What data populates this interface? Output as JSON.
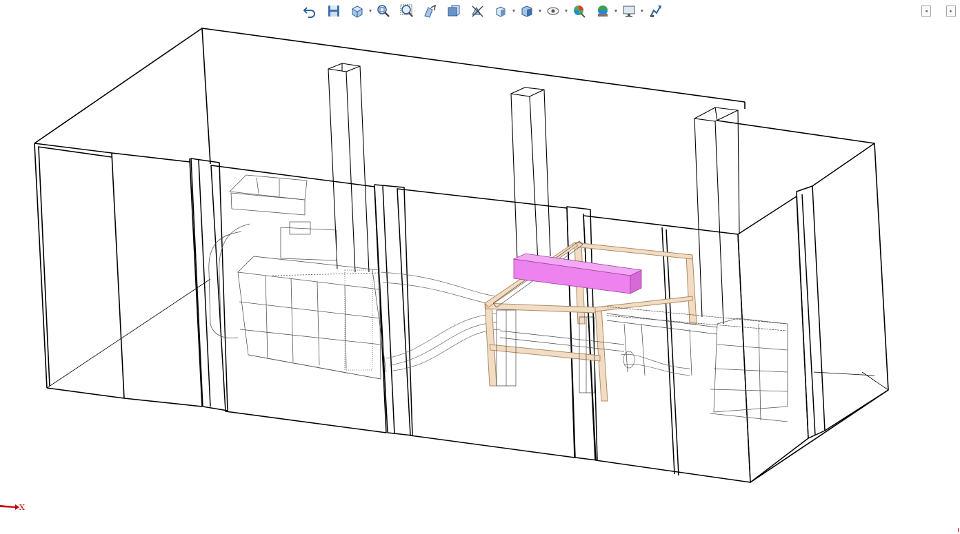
{
  "toolbar": {
    "items": [
      {
        "name": "undo-icon",
        "dropdown": false
      },
      {
        "name": "save-icon",
        "dropdown": false
      },
      {
        "name": "view-orientation-icon",
        "dropdown": true
      },
      {
        "name": "zoom-to-fit-icon",
        "dropdown": false
      },
      {
        "name": "zoom-to-area-icon",
        "dropdown": false
      },
      {
        "name": "previous-view-icon",
        "dropdown": false
      },
      {
        "name": "section-view-icon",
        "dropdown": false
      },
      {
        "name": "dynamic-annotation-icon",
        "dropdown": false
      },
      {
        "name": "view-cube-icon",
        "dropdown": true
      },
      {
        "name": "display-style-icon",
        "dropdown": true
      },
      {
        "name": "hide-show-items-icon",
        "dropdown": true
      },
      {
        "name": "edit-appearance-icon",
        "dropdown": false
      },
      {
        "name": "apply-scene-icon",
        "dropdown": true
      },
      {
        "name": "view-settings-icon",
        "dropdown": true
      },
      {
        "name": "rotate-view-icon",
        "dropdown": false
      }
    ]
  },
  "triad": {
    "axis_label": "X",
    "axis_color": "#c00000"
  },
  "colors": {
    "highlight_part": "#ee82ee",
    "frame_wood": "#e8c9a8",
    "edges": "#000000",
    "background": "#ffffff"
  }
}
